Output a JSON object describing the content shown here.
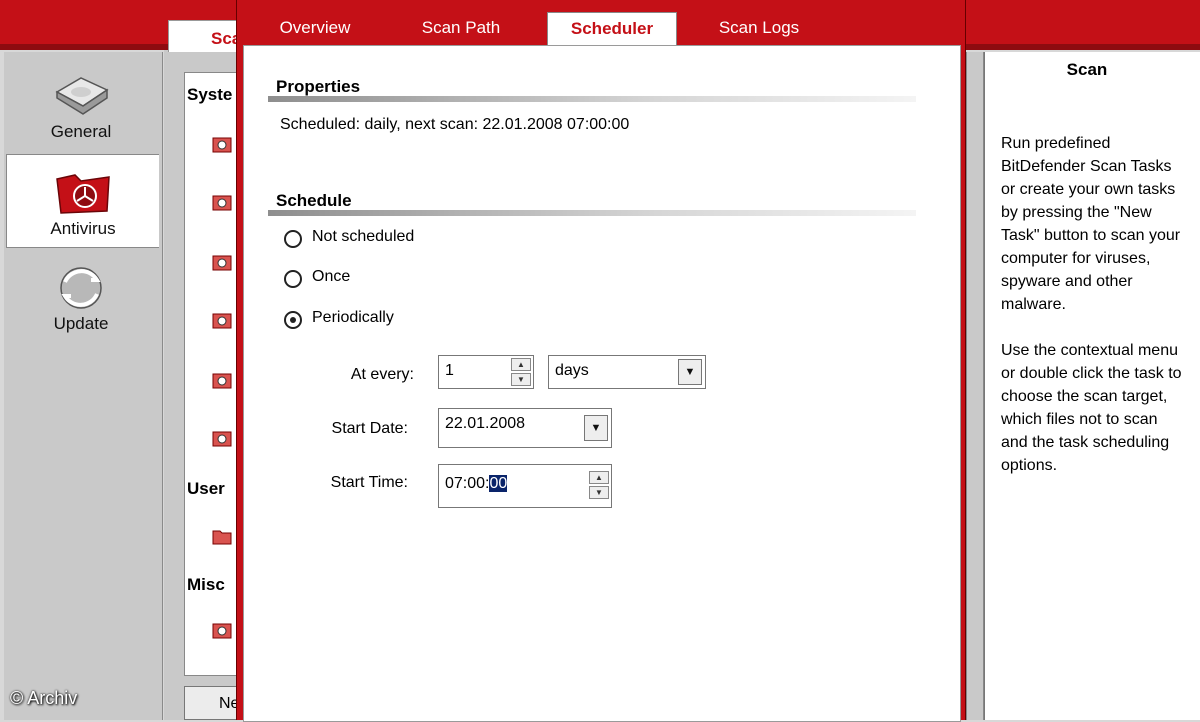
{
  "nav": {
    "items": [
      {
        "label": "General",
        "icon": "disk-icon"
      },
      {
        "label": "Antivirus",
        "icon": "virus-folder-icon",
        "active": true
      },
      {
        "label": "Update",
        "icon": "update-globe-icon"
      }
    ]
  },
  "background_window": {
    "tab_label": "Sca",
    "section_system": "Syste",
    "section_user": "User",
    "section_misc": "Misc",
    "button_label": "Ne"
  },
  "dialog": {
    "tabs": [
      {
        "label": "Overview"
      },
      {
        "label": "Scan Path"
      },
      {
        "label": "Scheduler",
        "active": true
      },
      {
        "label": "Scan Logs"
      }
    ],
    "properties": {
      "title": "Properties",
      "text": "Scheduled: daily, next scan: 22.01.2008 07:00:00"
    },
    "schedule": {
      "title": "Schedule",
      "options": [
        {
          "label": "Not scheduled",
          "checked": false
        },
        {
          "label": "Once",
          "checked": false
        },
        {
          "label": "Periodically",
          "checked": true
        }
      ],
      "at_every_label": "At every:",
      "at_every_value": "1",
      "unit_value": "days",
      "start_date_label": "Start Date:",
      "start_date_value": "22.01.2008",
      "start_time_label": "Start Time:",
      "start_time_prefix": "07:00:",
      "start_time_selected": "00"
    }
  },
  "help": {
    "title": "Scan",
    "paragraph1": "Run predefined BitDefender Scan Tasks or create your own tasks by pressing the \"New Task\" button to scan your computer for viruses, spyware and other malware.",
    "paragraph2": "Use the contextual menu or double click the task to choose the scan target, which files not to scan and the task scheduling options."
  },
  "watermark": "© Archiv",
  "colors": {
    "accent": "#c41017",
    "selection": "#0a246a"
  }
}
